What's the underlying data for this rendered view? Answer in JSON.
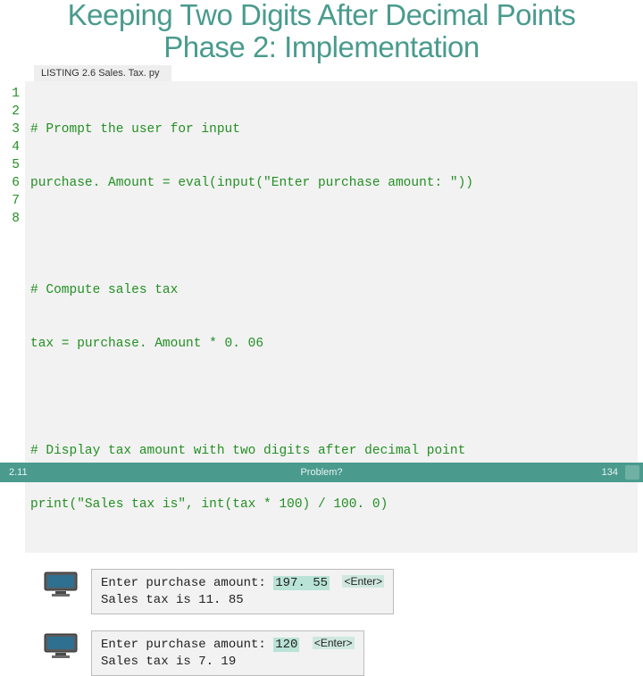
{
  "title": {
    "line1": "Keeping Two Digits After Decimal Points",
    "line2": "Phase 2: Implementation"
  },
  "listing_label": "LISTING 2.6 Sales. Tax. py",
  "code": {
    "line_numbers": [
      "1",
      "2",
      "3",
      "4",
      "5",
      "6",
      "7",
      "8"
    ],
    "lines": [
      "# Prompt the user for input",
      "purchase. Amount = eval(input(\"Enter purchase amount: \"))",
      "",
      "# Compute sales tax",
      "tax = purchase. Amount * 0. 06",
      "",
      "# Display tax amount with two digits after decimal point",
      "print(\"Sales tax is\", int(tax * 100) / 100. 0)"
    ]
  },
  "runs": [
    {
      "prompt": "Enter purchase amount: ",
      "input": "197. 55",
      "enter": "<Enter>",
      "result": "Sales tax is 11. 85"
    },
    {
      "prompt": "Enter purchase amount: ",
      "input": "120",
      "enter": "<Enter>",
      "result": "Sales tax is 7. 19"
    }
  ],
  "footer": {
    "left": "2.11",
    "center": "Problem?",
    "right": "134"
  }
}
